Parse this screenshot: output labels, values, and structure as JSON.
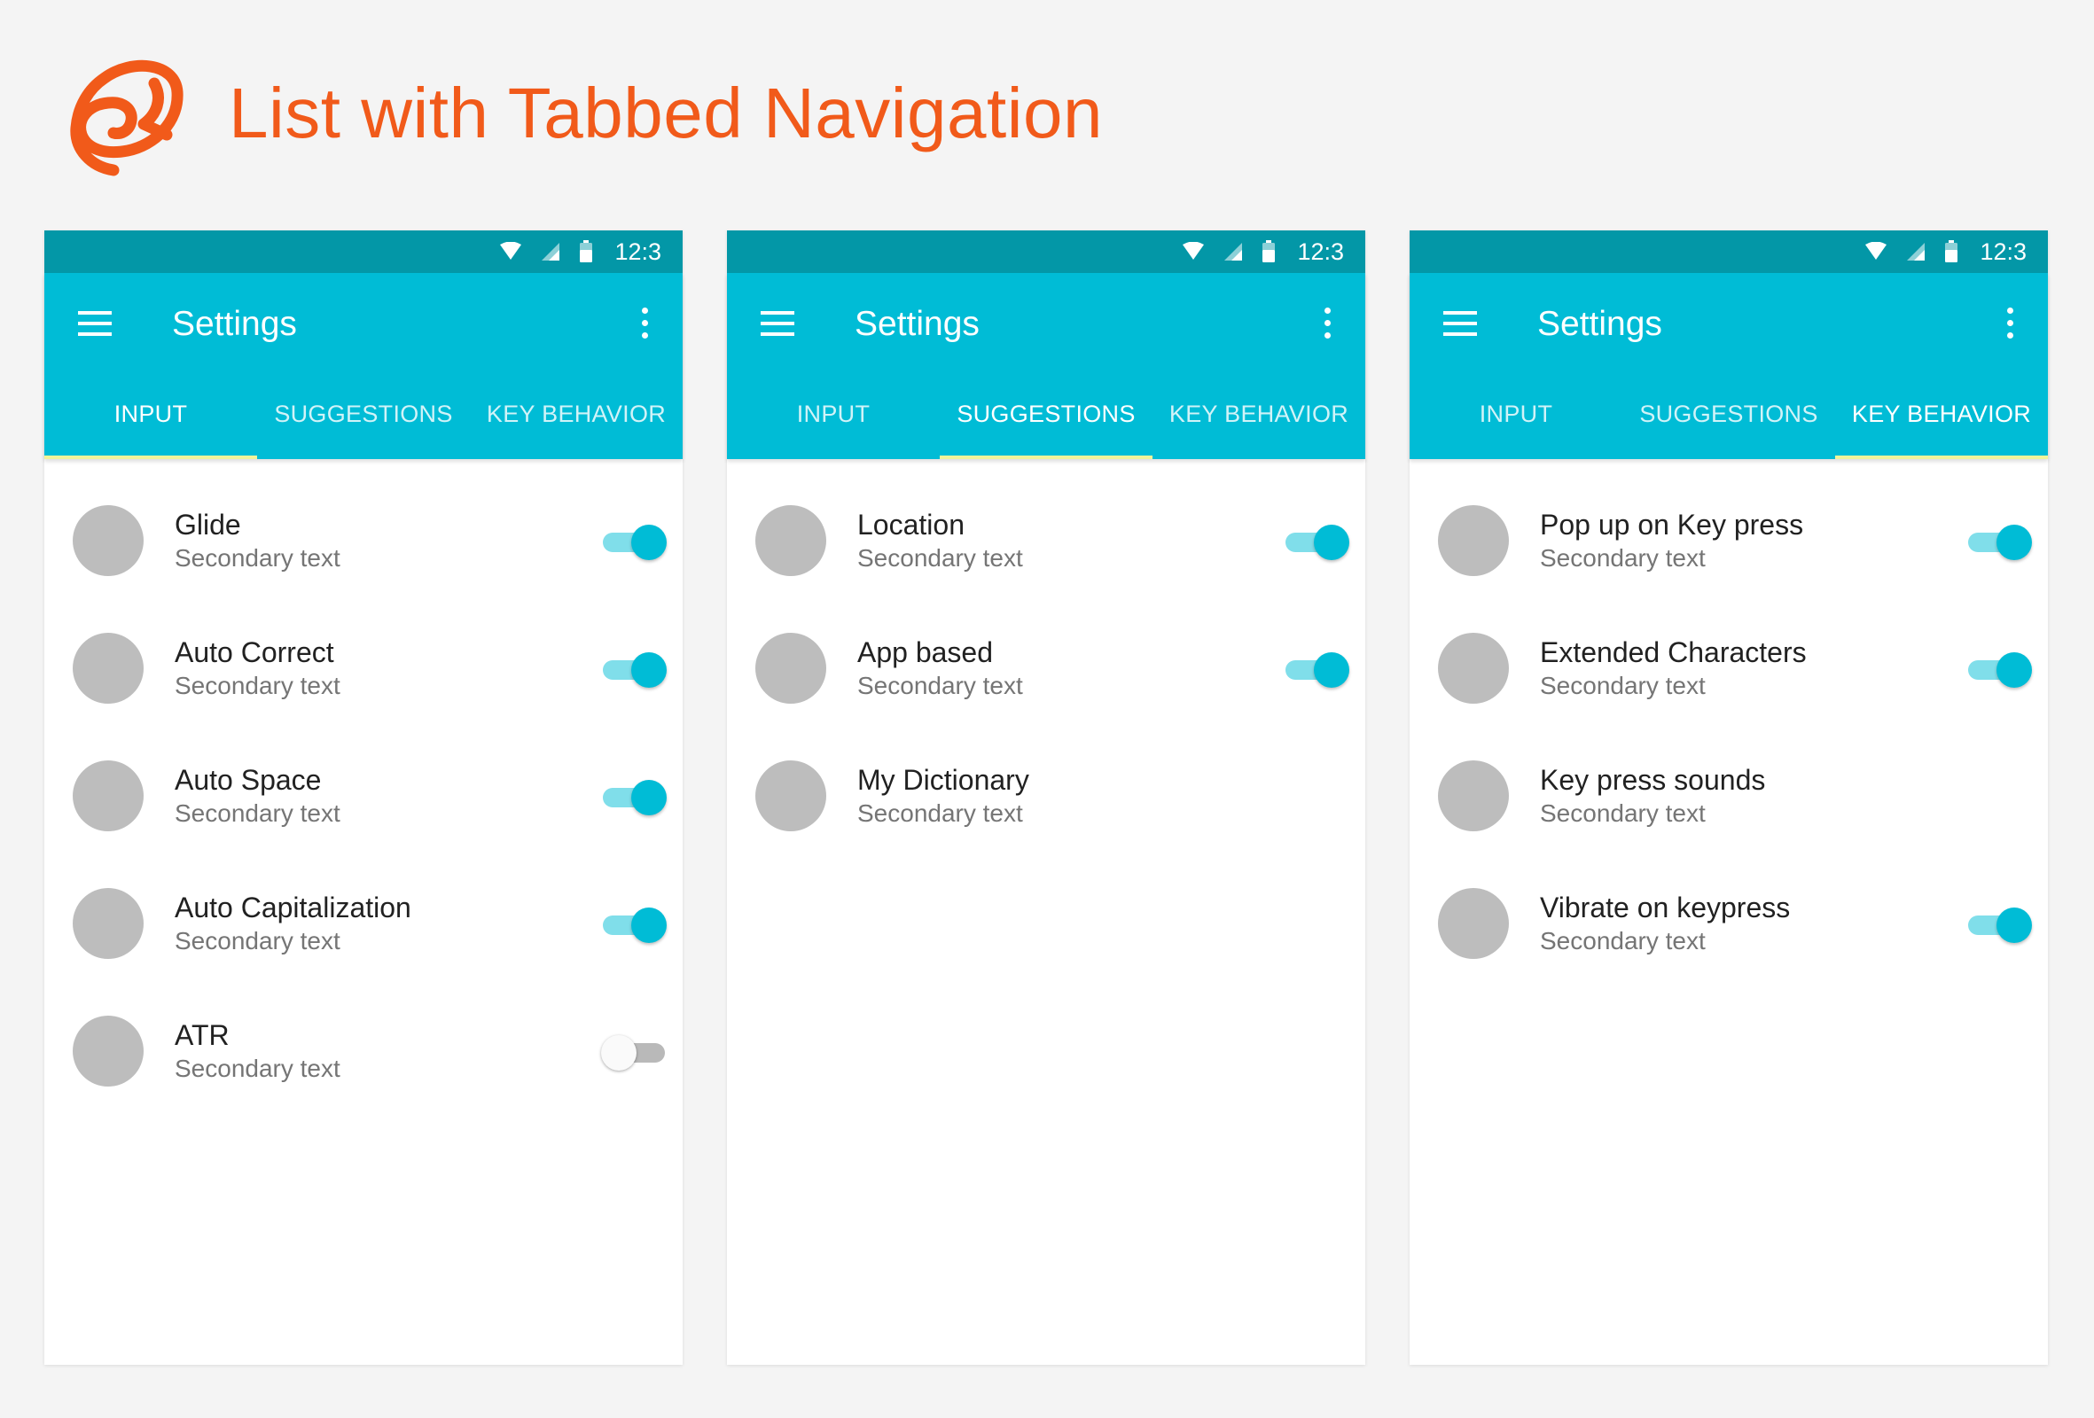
{
  "page": {
    "title": "List with Tabbed Navigation",
    "accent_color": "#f15a1a"
  },
  "logo": {
    "icon": "logo-icon"
  },
  "colors": {
    "status_bar": "#0397a7",
    "app_bar": "#00bcd6",
    "tab_indicator": "#f1f49a",
    "avatar": "#bdbdbd",
    "toggle_on": "#00bcd6"
  },
  "screens": [
    {
      "status": {
        "time": "12:3"
      },
      "app_bar": {
        "title": "Settings"
      },
      "tabs": [
        {
          "label": "INPUT",
          "active": true
        },
        {
          "label": "SUGGESTIONS",
          "active": false
        },
        {
          "label": "KEY BEHAVIOR",
          "active": false
        }
      ],
      "items": [
        {
          "primary": "Glide",
          "secondary": "Secondary text",
          "toggle": true
        },
        {
          "primary": "Auto Correct",
          "secondary": "Secondary text",
          "toggle": true
        },
        {
          "primary": "Auto Space",
          "secondary": "Secondary text",
          "toggle": true
        },
        {
          "primary": "Auto Capitalization",
          "secondary": "Secondary text",
          "toggle": true
        },
        {
          "primary": "ATR",
          "secondary": "Secondary text",
          "toggle": false
        }
      ]
    },
    {
      "status": {
        "time": "12:3"
      },
      "app_bar": {
        "title": "Settings"
      },
      "tabs": [
        {
          "label": "INPUT",
          "active": false
        },
        {
          "label": "SUGGESTIONS",
          "active": true
        },
        {
          "label": "KEY BEHAVIOR",
          "active": false
        }
      ],
      "items": [
        {
          "primary": "Location",
          "secondary": "Secondary text",
          "toggle": true
        },
        {
          "primary": "App based",
          "secondary": "Secondary text",
          "toggle": true
        },
        {
          "primary": "My Dictionary",
          "secondary": "Secondary text",
          "toggle": null
        }
      ]
    },
    {
      "status": {
        "time": "12:3"
      },
      "app_bar": {
        "title": "Settings"
      },
      "tabs": [
        {
          "label": "INPUT",
          "active": false
        },
        {
          "label": "SUGGESTIONS",
          "active": false
        },
        {
          "label": "KEY BEHAVIOR",
          "active": true
        }
      ],
      "items": [
        {
          "primary": "Pop up on Key press",
          "secondary": "Secondary text",
          "toggle": true
        },
        {
          "primary": "Extended Characters",
          "secondary": "Secondary text",
          "toggle": true
        },
        {
          "primary": "Key press sounds",
          "secondary": "Secondary text",
          "toggle": null
        },
        {
          "primary": "Vibrate on keypress",
          "secondary": "Secondary text",
          "toggle": true
        }
      ]
    }
  ]
}
